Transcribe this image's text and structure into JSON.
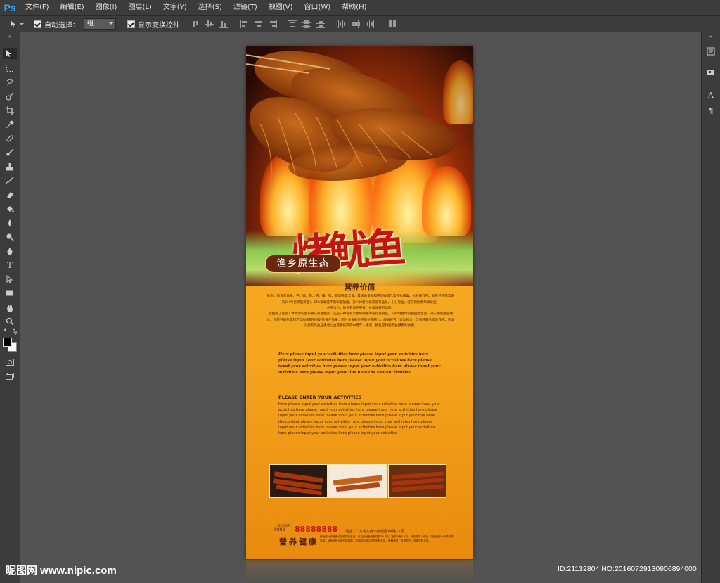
{
  "app": {
    "logo_text": "Ps",
    "menu": [
      "文件(F)",
      "编辑(E)",
      "图像(I)",
      "图层(L)",
      "文字(Y)",
      "选择(S)",
      "滤镜(T)",
      "视图(V)",
      "窗口(W)",
      "帮助(H)"
    ]
  },
  "options": {
    "auto_select_label": "自动选择：",
    "auto_select_value": "组",
    "show_transform_label": "显示变换控件"
  },
  "poster": {
    "title": "烤鱿鱼",
    "badge": "渔乡原生态",
    "section_title": "营养价值",
    "cn_para_1": "鱿鱼，富含蛋白质、钙、磷、铁、硒、碘、锰、铜等微量元素，其含的多肽和硒等微量元素有抗病毒、抗射线作用。鱿鱼还含有丰富的DHA(俗称脑黄金)、EPA等高度不饱和脂肪酸，对人体智力发育很有益处，十分有益，还可预防老年痴呆症。",
    "cn_para_2": "中医认为，鱿鱼有滋阴养胃、补虚润肤的功能。",
    "cn_para_3": "鱿鱼除了富含人体所需的蛋白质与氨基酸外，还是一种含有大量牛磺酸的低热量食品。可抑制血中的胆固醇含量，对于预防血管硬化、胆结石的形成和老年痴呆都有很好的食疗效果，同时多食鱿鱼还能补充脑力、缓解疲劳、恢复视力、改善肝脏功能等作用。因此对患有高血压患者心血管疾病病的中老年人来说，鱿鱼是特别有益健康的食物。",
    "script_text": "Here please input your activities here please input your activities here please input your activities here please input your activities here please input your activities here please input your activities here please input your activities here please input your line here the content limities",
    "en_head": "PLEASE ENTER YOUR ACTIVITIES",
    "en_body": "Here please input your activities here please input your activities here please input your activities here please input your activities here please input your activities here please input your activities here please input your activities here please Input your five here the content please input your activities here please input your activities here please input your activities here please input your activities here please input your activities here please input your activities here please input your activities",
    "phone_label": "预订电话",
    "phone_prefix": "8888",
    "phone": "88888888",
    "address": "地址：广东省东莞市南城区XX路XX号",
    "slogan": "营养健康",
    "footer_text": "鱿鱼是一种营养价值很高的食品，每百克鱿鱼含蛋白质16.4克，脂肪只有0.4克，对怕胖的人来说，吃鱿鱼是一种很好的选择。鱿鱼含有大量的牛磺酸，可抑制血液中的胆固醇含量，缓解疲劳，恢复视力，改善肝脏功能。"
  },
  "watermark": {
    "left": "昵图网 www.nipic.com",
    "right": "ID:21132804 NO:20160729130906894000"
  }
}
